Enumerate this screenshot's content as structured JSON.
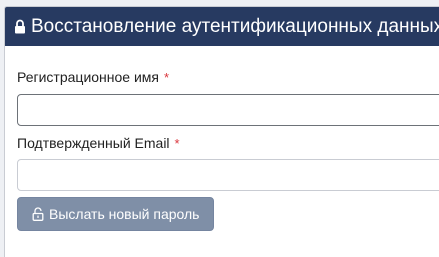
{
  "header": {
    "title": "Восстановление аутентификационных данных",
    "icon": "lock-icon",
    "background": "#273a61"
  },
  "form": {
    "username": {
      "label": "Регистрационное имя",
      "required_mark": "*",
      "value": ""
    },
    "email": {
      "label": "Подтвержденный Email",
      "required_mark": "*",
      "value": ""
    },
    "submit": {
      "label": "Выслать новый пароль",
      "icon": "unlock-icon"
    }
  },
  "colors": {
    "required": "#d9343b",
    "button": "#7f8fa7"
  }
}
